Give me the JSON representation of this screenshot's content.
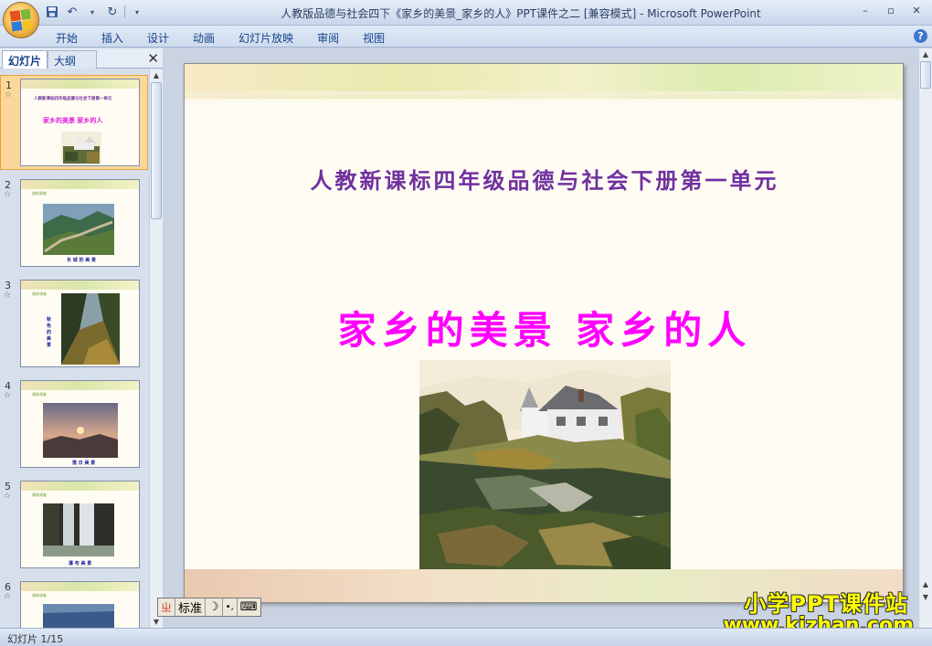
{
  "window": {
    "title": "人教版品德与社会四下《家乡的美景_家乡的人》PPT课件之二 [兼容模式] - Microsoft PowerPoint",
    "minimize": "–",
    "restore": "▫",
    "close": "✕"
  },
  "ribbon": {
    "tabs": [
      "开始",
      "插入",
      "设计",
      "动画",
      "幻灯片放映",
      "审阅",
      "视图"
    ],
    "help": "?"
  },
  "pane": {
    "tab_slides": "幻灯片",
    "tab_outline": "大纲",
    "close": "✕"
  },
  "slides": [
    {
      "num": "1",
      "star": "☆",
      "tag": "",
      "caption": ""
    },
    {
      "num": "2",
      "star": "☆",
      "tag": "课前调查",
      "caption": "长 城 的 美 景"
    },
    {
      "num": "3",
      "star": "☆",
      "tag": "课前调查",
      "caption": "秋 色 的 美 景"
    },
    {
      "num": "4",
      "star": "☆",
      "tag": "课前调查",
      "caption": "落 日 美 景"
    },
    {
      "num": "5",
      "star": "☆",
      "tag": "课前调查",
      "caption": "瀑 布 美 景"
    },
    {
      "num": "6",
      "star": "☆",
      "tag": "课前调查",
      "caption": ""
    }
  ],
  "slide1_thumb": {
    "line1": "人教新课标四年级品德与社会下册第一单元",
    "line2": "家乡的美景 家乡的人"
  },
  "main_slide": {
    "subtitle": "人教新课标四年级品德与社会下册第一单元",
    "title": "家乡的美景 家乡的人"
  },
  "ime": {
    "logo": "ㄓ",
    "mode": "标准",
    "moon": "☽",
    "punct": "•,",
    "keyboard": "⌨"
  },
  "watermark": {
    "line1": "小学PPT课件站",
    "line2": "www.kjzhan.com"
  },
  "status": {
    "slide_indicator": "幻灯片 1/15"
  }
}
